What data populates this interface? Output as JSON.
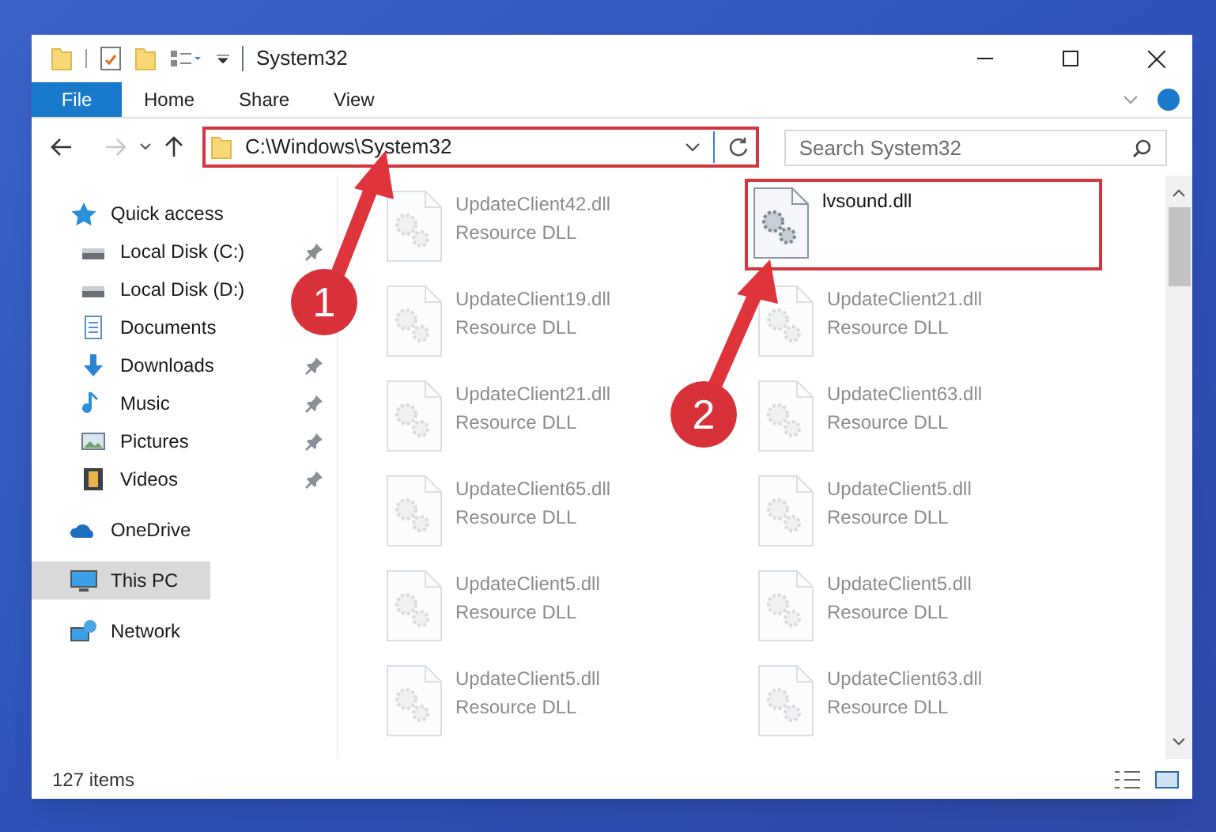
{
  "window": {
    "title": "System32"
  },
  "ribbon_tabs": [
    {
      "label": "File",
      "selected": true
    },
    {
      "label": "Home",
      "selected": false
    },
    {
      "label": "Share",
      "selected": false
    },
    {
      "label": "View",
      "selected": false
    }
  ],
  "address": {
    "path": "C:\\Windows\\System32",
    "highlighted": true
  },
  "search": {
    "placeholder": "Search System32"
  },
  "sidebar": {
    "items": [
      {
        "label": "Quick access",
        "kind": "star",
        "pinned": false,
        "selected": false,
        "children": [
          {
            "label": "Local Disk (C:)",
            "kind": "drive",
            "pinned": true,
            "selected": false
          },
          {
            "label": "Local Disk (D:)",
            "kind": "drive",
            "pinned": false,
            "selected": false
          },
          {
            "label": "Documents",
            "kind": "document",
            "pinned": false,
            "selected": false
          },
          {
            "label": "Downloads",
            "kind": "download",
            "pinned": true,
            "selected": false
          },
          {
            "label": "Music",
            "kind": "music",
            "pinned": true,
            "selected": false
          },
          {
            "label": "Pictures",
            "kind": "pictures",
            "pinned": true,
            "selected": false
          },
          {
            "label": "Videos",
            "kind": "videos",
            "pinned": true,
            "selected": false
          }
        ]
      },
      {
        "label": "OneDrive",
        "kind": "cloud",
        "pinned": false,
        "selected": false
      },
      {
        "label": "This PC",
        "kind": "pc",
        "pinned": false,
        "selected": true
      },
      {
        "label": "Network",
        "kind": "network",
        "pinned": false,
        "selected": false
      }
    ]
  },
  "files": [
    {
      "name": "UpdateClient42.dll",
      "type": "Resource DLL",
      "highlighted": false
    },
    {
      "name": "lvsound.dll",
      "highlighted": true
    },
    {
      "name": "UpdateClient19.dll",
      "type": "Resource DLL",
      "highlighted": false
    },
    {
      "name": "UpdateClient21.dll",
      "type": "Resource DLL",
      "highlighted": false
    },
    {
      "name": "UpdateClient21.dll",
      "type": "Resource DLL",
      "highlighted": false
    },
    {
      "name": "UpdateClient63.dll",
      "type": "Resource DLL",
      "highlighted": false
    },
    {
      "name": "UpdateClient65.dll",
      "type": "Resource DLL",
      "highlighted": false
    },
    {
      "name": "UpdateClient5.dll",
      "type": "Resource DLL",
      "highlighted": false
    },
    {
      "name": "UpdateClient5.dll",
      "type": "Resource DLL",
      "highlighted": false
    },
    {
      "name": "UpdateClient5.dll",
      "type": "Resource DLL",
      "highlighted": false
    },
    {
      "name": "UpdateClient5.dll",
      "type": "Resource DLL",
      "highlighted": false
    },
    {
      "name": "UpdateClient63.dll",
      "type": "Resource DLL",
      "highlighted": false
    }
  ],
  "callouts": [
    {
      "label": "1"
    },
    {
      "label": "2"
    }
  ],
  "status_bar": {
    "count": "127 items"
  }
}
